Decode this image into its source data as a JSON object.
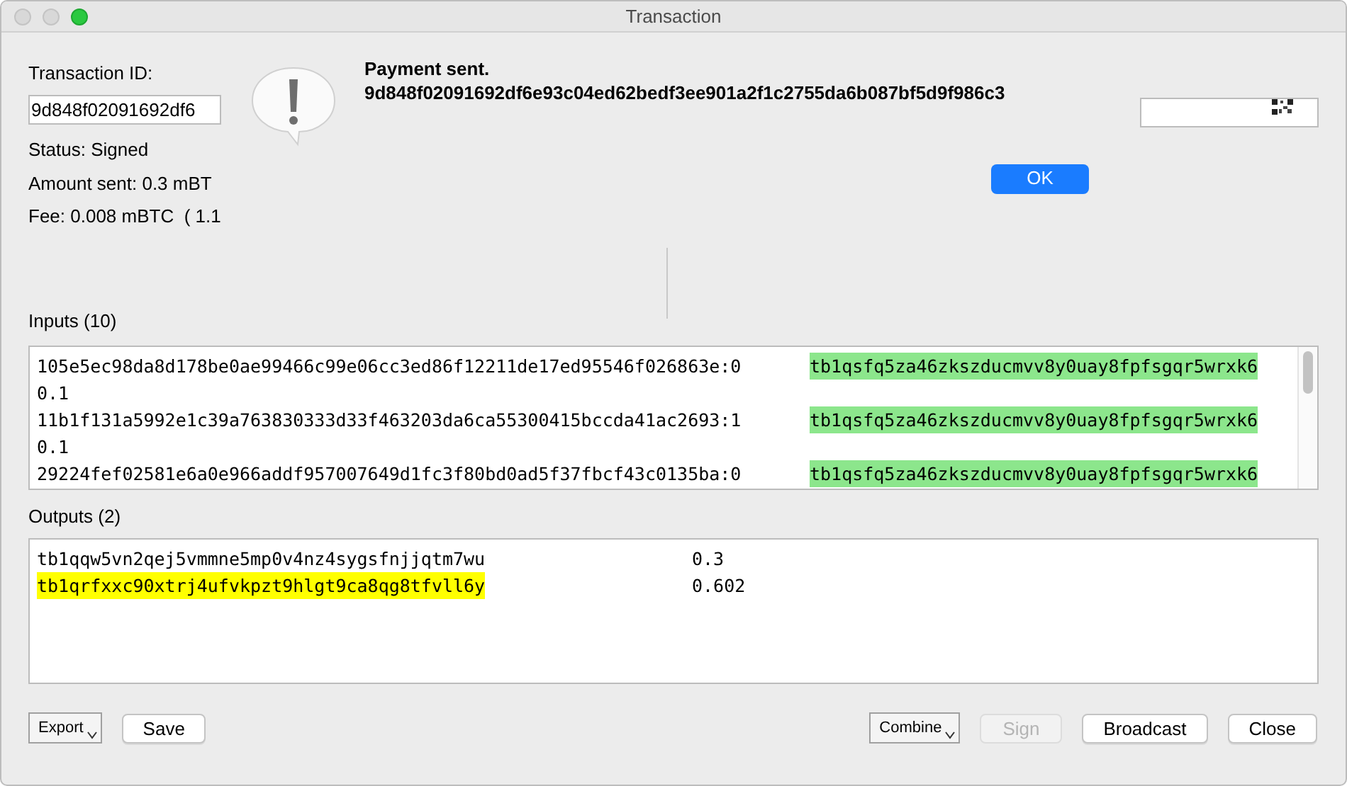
{
  "window": {
    "title": "Transaction"
  },
  "dialog": {
    "title": "Payment sent.",
    "message": "9d848f02091692df6e93c04ed62bedf3ee901a2f1c2755da6b087bf5d9f986c3",
    "button": "OK"
  },
  "details": {
    "transaction_id_label": "Transaction ID:",
    "transaction_id_value": "9d848f02091692df6",
    "status": "Status: Signed",
    "amount_sent": "Amount sent: 0.3 mBT",
    "fee": "Fee: 0.008 mBTC  ( 1.1"
  },
  "inputs": {
    "label": "Inputs (10)",
    "rows": [
      {
        "prevout": "105e5ec98da8d178be0ae99466c99e06cc3ed86f12211de17ed95546f026863e:0",
        "address": "tb1qsfq5za46zkszducmvv8y0uay8fpfsgqr5wrxk6",
        "highlighted": true,
        "amount": "0.1"
      },
      {
        "prevout": "11b1f131a5992e1c39a763830333d33f463203da6ca55300415bccda41ac2693:1",
        "address": "tb1qsfq5za46zkszducmvv8y0uay8fpfsgqr5wrxk6",
        "highlighted": true,
        "amount": "0.1"
      },
      {
        "prevout": "29224fef02581e6a0e966addf957007649d1fc3f80bd0ad5f37fbcf43c0135ba:0",
        "address": "tb1qsfq5za46zkszducmvv8y0uay8fpfsgqr5wrxk6",
        "highlighted": true
      }
    ]
  },
  "outputs": {
    "label": "Outputs (2)",
    "rows": [
      {
        "address": "tb1qqw5vn2qej5vmmne5mp0v4nz4sygsfnjjqtm7wu",
        "amount": "0.3",
        "highlighted": false
      },
      {
        "address": "tb1qrfxxc90xtrj4ufvkpzt9hlgt9ca8qg8tfvll6y",
        "amount": "0.602",
        "highlighted": true
      }
    ]
  },
  "buttons_left": [
    {
      "label": "Export",
      "kind": "menu",
      "disabled": false
    },
    {
      "label": "Save",
      "kind": "push",
      "disabled": false
    }
  ],
  "buttons_right": [
    {
      "label": "Combine",
      "kind": "menu",
      "disabled": false
    },
    {
      "label": "Sign",
      "kind": "push",
      "disabled": true
    },
    {
      "label": "Broadcast",
      "kind": "push",
      "disabled": false
    },
    {
      "label": "Close",
      "kind": "push",
      "disabled": false
    }
  ]
}
